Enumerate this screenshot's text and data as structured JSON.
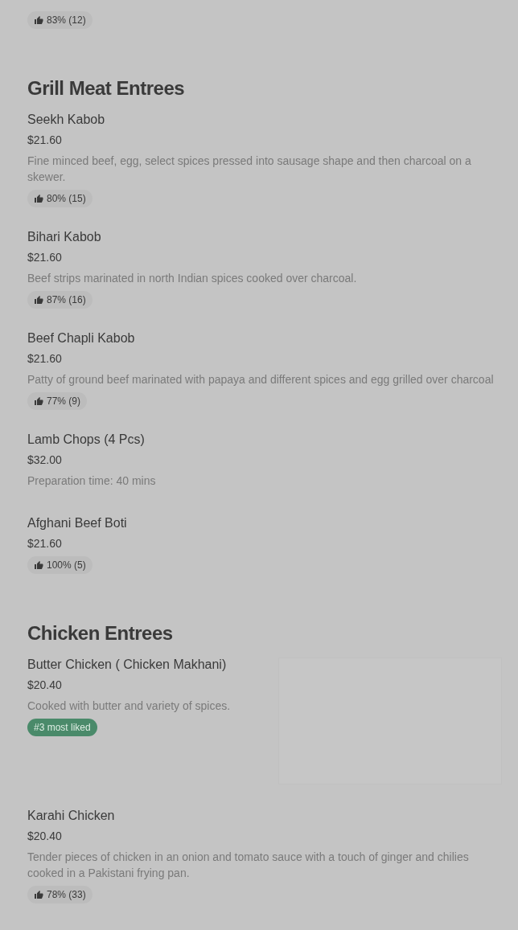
{
  "top_badge": {
    "kind": "rating",
    "text": "83% (12)"
  },
  "sections": [
    {
      "title": "Grill Meat Entrees",
      "items": [
        {
          "name": "Seekh Kabob",
          "price": "$21.60",
          "description": "Fine minced beef, egg, select spices pressed into sausage shape and then charcoal on a skewer.",
          "badge": {
            "kind": "rating",
            "text": "80% (15)"
          }
        },
        {
          "name": "Bihari Kabob",
          "price": "$21.60",
          "description": "Beef strips marinated in north Indian spices cooked over charcoal.",
          "badge": {
            "kind": "rating",
            "text": "87% (16)"
          }
        },
        {
          "name": "Beef Chapli Kabob",
          "price": "$21.60",
          "description": "Patty of ground beef marinated with papaya and different spices and egg grilled over charcoal",
          "badge": {
            "kind": "rating",
            "text": "77% (9)"
          }
        },
        {
          "name": "Lamb Chops (4 Pcs)",
          "price": "$32.00",
          "description": "Preparation time: 40 mins"
        },
        {
          "name": "Afghani Beef Boti",
          "price": "$21.60",
          "badge": {
            "kind": "rating",
            "text": "100% (5)"
          }
        }
      ]
    },
    {
      "title": "Chicken Entrees",
      "items": [
        {
          "name": "Butter Chicken ( Chicken Makhani)",
          "price": "$20.40",
          "description": "Cooked with butter and variety of spices.",
          "badge": {
            "kind": "rank",
            "text": "#3 most liked"
          }
        },
        {
          "name": "Karahi Chicken",
          "price": "$20.40",
          "description": "Tender pieces of chicken in an onion and tomato sauce with a touch of ginger and chilies cooked in a Pakistani frying pan.",
          "badge": {
            "kind": "rating",
            "text": "78% (33)"
          }
        }
      ]
    }
  ]
}
